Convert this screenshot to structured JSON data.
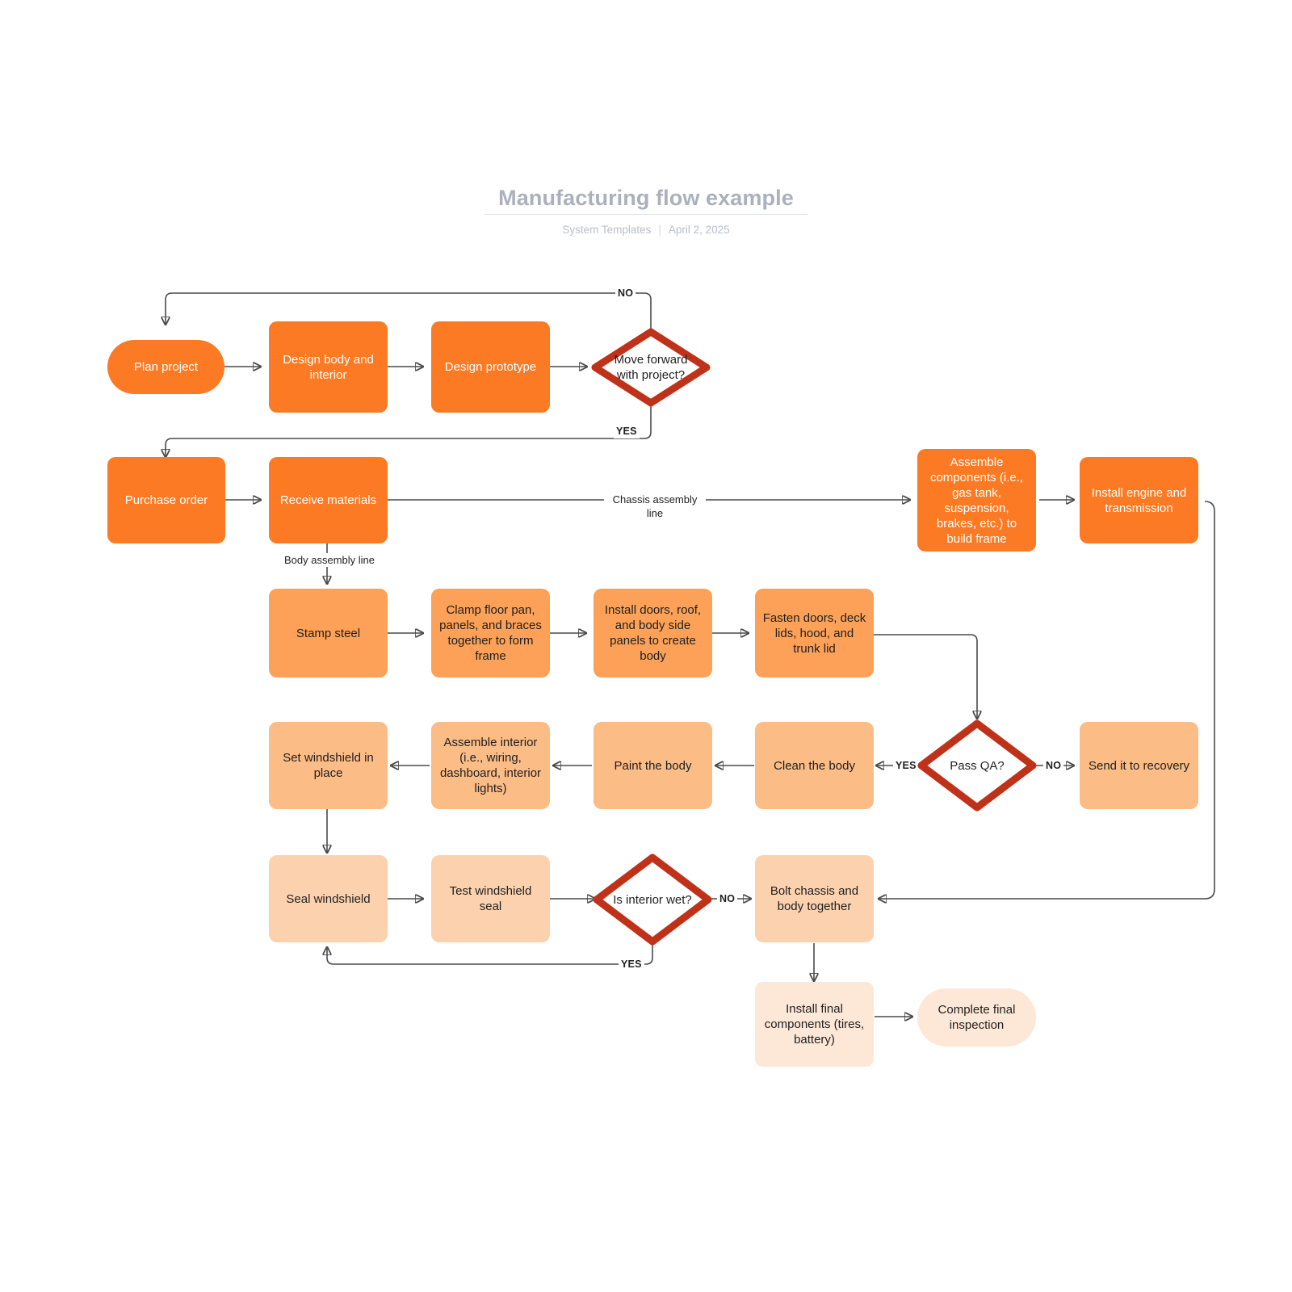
{
  "header": {
    "title": "Manufacturing flow example",
    "author": "System Templates",
    "separator": "|",
    "date": "April 2, 2025"
  },
  "colors": {
    "tone1": "#fb7a23",
    "tone2": "#fca157",
    "tone3": "#fcbc86",
    "tone4": "#fcd2ae",
    "tone5": "#fde7d7",
    "decision_border": "#bf3219",
    "edge": "#4a4a4a",
    "title": "#aab0bd"
  },
  "diagram": {
    "type": "flowchart",
    "nodes": [
      {
        "id": "plan",
        "label": "Plan project",
        "shape": "pill",
        "tone": "tone1"
      },
      {
        "id": "design_body",
        "label": "Design body and interior",
        "shape": "rounded",
        "tone": "tone1"
      },
      {
        "id": "design_proto",
        "label": "Design prototype",
        "shape": "rounded",
        "tone": "tone1"
      },
      {
        "id": "move_fwd",
        "label": "Move forward with project?",
        "shape": "diamond",
        "tone": "decision"
      },
      {
        "id": "purchase",
        "label": "Purchase order",
        "shape": "rounded",
        "tone": "tone1"
      },
      {
        "id": "receive",
        "label": "Receive materials",
        "shape": "rounded",
        "tone": "tone1"
      },
      {
        "id": "assemble_cmp",
        "label": "Assemble components (i.e., gas tank, suspension, brakes, etc.) to build frame",
        "shape": "rounded",
        "tone": "tone1"
      },
      {
        "id": "install_eng",
        "label": "Install engine and transmission",
        "shape": "rounded",
        "tone": "tone1"
      },
      {
        "id": "stamp",
        "label": "Stamp steel",
        "shape": "rounded",
        "tone": "tone2"
      },
      {
        "id": "clamp",
        "label": "Clamp floor pan, panels, and braces together to form frame",
        "shape": "rounded",
        "tone": "tone2"
      },
      {
        "id": "install_door",
        "label": "Install doors, roof, and body side panels to create body",
        "shape": "rounded",
        "tone": "tone2"
      },
      {
        "id": "fasten",
        "label": "Fasten doors, deck lids, hood, and trunk lid",
        "shape": "rounded",
        "tone": "tone2"
      },
      {
        "id": "set_wind",
        "label": "Set windshield in place",
        "shape": "rounded",
        "tone": "tone3"
      },
      {
        "id": "assemble_int",
        "label": "Assemble interior (i.e., wiring, dashboard, interior lights)",
        "shape": "rounded",
        "tone": "tone3"
      },
      {
        "id": "paint",
        "label": "Paint the body",
        "shape": "rounded",
        "tone": "tone3"
      },
      {
        "id": "clean",
        "label": "Clean the body",
        "shape": "rounded",
        "tone": "tone3"
      },
      {
        "id": "pass_qa",
        "label": "Pass QA?",
        "shape": "diamond",
        "tone": "decision"
      },
      {
        "id": "recovery",
        "label": "Send it to recovery",
        "shape": "rounded",
        "tone": "tone3"
      },
      {
        "id": "seal",
        "label": "Seal windshield",
        "shape": "rounded",
        "tone": "tone4"
      },
      {
        "id": "test_seal",
        "label": "Test windshield seal",
        "shape": "rounded",
        "tone": "tone4"
      },
      {
        "id": "int_wet",
        "label": "Is interior wet?",
        "shape": "diamond",
        "tone": "decision"
      },
      {
        "id": "bolt",
        "label": "Bolt chassis and body together",
        "shape": "rounded",
        "tone": "tone4"
      },
      {
        "id": "final_comp",
        "label": "Install final components (tires, battery)",
        "shape": "rounded",
        "tone": "tone5"
      },
      {
        "id": "final_insp",
        "label": "Complete final inspection",
        "shape": "pill",
        "tone": "tone5"
      }
    ],
    "edges": [
      {
        "from": "plan",
        "to": "design_body",
        "label": ""
      },
      {
        "from": "design_body",
        "to": "design_proto",
        "label": ""
      },
      {
        "from": "design_proto",
        "to": "move_fwd",
        "label": ""
      },
      {
        "from": "move_fwd",
        "to": "plan",
        "label": "NO"
      },
      {
        "from": "move_fwd",
        "to": "purchase",
        "label": "YES"
      },
      {
        "from": "purchase",
        "to": "receive",
        "label": ""
      },
      {
        "from": "receive",
        "to": "assemble_cmp",
        "label": "Chassis assembly line"
      },
      {
        "from": "assemble_cmp",
        "to": "install_eng",
        "label": ""
      },
      {
        "from": "receive",
        "to": "stamp",
        "label": "Body assembly line"
      },
      {
        "from": "stamp",
        "to": "clamp",
        "label": ""
      },
      {
        "from": "clamp",
        "to": "install_door",
        "label": ""
      },
      {
        "from": "install_door",
        "to": "fasten",
        "label": ""
      },
      {
        "from": "fasten",
        "to": "pass_qa",
        "label": ""
      },
      {
        "from": "pass_qa",
        "to": "clean",
        "label": "YES"
      },
      {
        "from": "pass_qa",
        "to": "recovery",
        "label": "NO"
      },
      {
        "from": "clean",
        "to": "paint",
        "label": ""
      },
      {
        "from": "paint",
        "to": "assemble_int",
        "label": ""
      },
      {
        "from": "assemble_int",
        "to": "set_wind",
        "label": ""
      },
      {
        "from": "set_wind",
        "to": "seal",
        "label": ""
      },
      {
        "from": "seal",
        "to": "test_seal",
        "label": ""
      },
      {
        "from": "test_seal",
        "to": "int_wet",
        "label": ""
      },
      {
        "from": "int_wet",
        "to": "bolt",
        "label": "NO"
      },
      {
        "from": "int_wet",
        "to": "seal",
        "label": "YES"
      },
      {
        "from": "install_eng",
        "to": "bolt",
        "label": ""
      },
      {
        "from": "bolt",
        "to": "final_comp",
        "label": ""
      },
      {
        "from": "final_comp",
        "to": "final_insp",
        "label": ""
      }
    ],
    "edge_labels": {
      "no_top": "NO",
      "yes_top": "YES",
      "chassis": "Chassis assembly line",
      "body": "Body assembly line",
      "qa_yes": "YES",
      "qa_no": "NO",
      "wet_no": "NO",
      "wet_yes": "YES"
    }
  }
}
